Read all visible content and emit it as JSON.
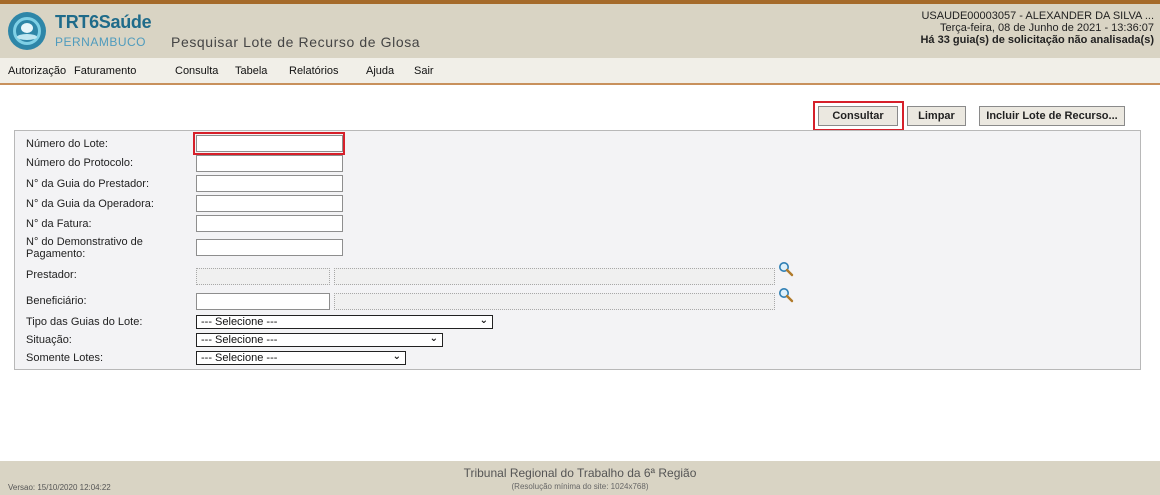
{
  "header": {
    "logo_title": "TRT6Saúde",
    "logo_sub": "PERNAMBUCO",
    "page_title": "Pesquisar Lote de Recurso de Glosa",
    "user_line": "USAUDE00003057 - ALEXANDER DA SILVA ...",
    "date_line": "Terça-feira, 08 de Junho de 2021 - 13:36:07",
    "pending_line": "Há 33 guia(s) de solicitação não analisada(s)"
  },
  "menu": {
    "items": [
      "Autorização",
      "Faturamento",
      "Consulta",
      "Tabela",
      "Relatórios",
      "Ajuda",
      "Sair"
    ]
  },
  "actions": {
    "consultar": "Consultar",
    "limpar": "Limpar",
    "incluir": "Incluir Lote de Recurso..."
  },
  "form": {
    "numero_lote": {
      "label": "Número do Lote:",
      "value": ""
    },
    "numero_protocolo": {
      "label": "Número do Protocolo:",
      "value": ""
    },
    "guia_prestador": {
      "label": "N° da Guia do Prestador:",
      "value": ""
    },
    "guia_operadora": {
      "label": "N° da Guia da Operadora:",
      "value": ""
    },
    "fatura": {
      "label": "N° da Fatura:",
      "value": ""
    },
    "demonstrativo": {
      "label_line1": "N° do Demonstrativo de",
      "label_line2": "Pagamento:",
      "value": ""
    },
    "prestador": {
      "label": "Prestador:",
      "code": "",
      "name": ""
    },
    "beneficiario": {
      "label": "Beneficiário:",
      "code": "",
      "name": ""
    },
    "tipo_guias": {
      "label": "Tipo das Guias do Lote:",
      "selected": "--- Selecione ---"
    },
    "situacao": {
      "label": "Situação:",
      "selected": "--- Selecione ---"
    },
    "somente_lotes": {
      "label": "Somente Lotes:",
      "selected": "--- Selecione ---"
    }
  },
  "footer": {
    "org": "Tribunal Regional do Trabalho da 6ª Região",
    "resolution": "(Resolução mínima do site: 1024x768)",
    "version": "Versao: 15/10/2020 12:04:22"
  },
  "colors": {
    "header_bg": "#d9d4c4",
    "accent": "#a56a2a",
    "highlight": "#d6202a",
    "brand": "#1f6b8a"
  }
}
